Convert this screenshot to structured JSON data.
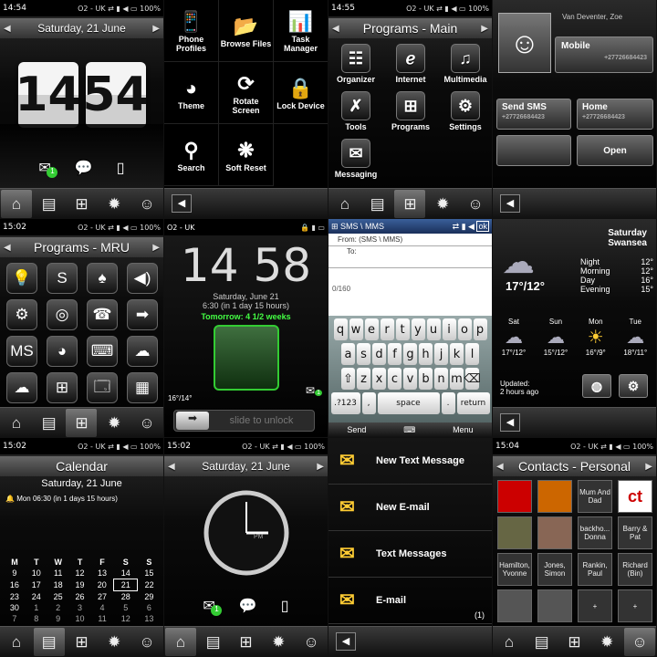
{
  "p1": {
    "time": "14:54",
    "carrier": "O2 - UK",
    "battery": "100%",
    "date": "Saturday, 21 June",
    "hour": "14",
    "minute": "54",
    "badge": "1"
  },
  "p2": {
    "tiles": [
      {
        "icon": "phone-icon",
        "glyph": "📱",
        "label": "Phone\nProfiles"
      },
      {
        "icon": "folder-icon",
        "glyph": "📂",
        "label": "Browse Files"
      },
      {
        "icon": "task-icon",
        "glyph": "📊",
        "label": "Task\nManager"
      },
      {
        "icon": "theme-icon",
        "glyph": "◕",
        "label": "Theme"
      },
      {
        "icon": "rotate-icon",
        "glyph": "⟳",
        "label": "Rotate\nScreen"
      },
      {
        "icon": "lock-icon",
        "glyph": "🔒",
        "label": "Lock Device"
      },
      {
        "icon": "search-icon",
        "glyph": "⚲",
        "label": "Search"
      },
      {
        "icon": "reset-icon",
        "glyph": "❋",
        "label": "Soft Reset"
      }
    ]
  },
  "p3": {
    "time": "14:55",
    "carrier": "O2 - UK",
    "battery": "100%",
    "title": "Programs - Main",
    "items": [
      {
        "icon": "organizer-icon",
        "glyph": "☷",
        "label": "Organizer"
      },
      {
        "icon": "internet-icon",
        "glyph": "ℯ",
        "label": "Internet"
      },
      {
        "icon": "multimedia-icon",
        "glyph": "♫",
        "label": "Multimedia"
      },
      {
        "icon": "tools-icon",
        "glyph": "✗",
        "label": "Tools"
      },
      {
        "icon": "programs-icon",
        "glyph": "⊞",
        "label": "Programs"
      },
      {
        "icon": "settings-icon",
        "glyph": "⚙",
        "label": "Settings"
      },
      {
        "icon": "messaging-icon",
        "glyph": "✉",
        "label": "Messaging"
      }
    ]
  },
  "p4": {
    "name": "Van Deventer, Zoe",
    "mobile_label": "Mobile",
    "mobile_num": "+27726684423",
    "sms_label": "Send SMS",
    "sms_num": "+27726684423",
    "home_label": "Home",
    "home_num": "+27726684423",
    "open_label": "Open"
  },
  "p5": {
    "time": "15:02",
    "carrier": "O2 - UK",
    "battery": "100%",
    "title": "Programs - MRU",
    "icons": [
      "💡",
      "S",
      "♠",
      "◀)",
      "⚙",
      "◎",
      "☎",
      "➡",
      "MS",
      "◕",
      "⌨",
      "☁",
      "☁",
      "⊞",
      "🗔",
      "▦"
    ]
  },
  "p6": {
    "carrier": "O2 - UK",
    "hour": "14",
    "minute": "58",
    "date": "Saturday, June 21",
    "alarm": "6:30 (in 1 day 15 hours)",
    "tomorrow": "Tomorrow: 4 1/2 weeks",
    "temp": "16°/14°",
    "unlock": "slide to unlock",
    "badge": "1"
  },
  "p7": {
    "title": "SMS \\ MMS",
    "ok": "ok",
    "from_label": "From:",
    "from_val": "(SMS \\ MMS)",
    "to_label": "To:",
    "count": "0/160",
    "rows": [
      [
        "q",
        "w",
        "e",
        "r",
        "t",
        "y",
        "u",
        "i",
        "o",
        "p"
      ],
      [
        "a",
        "s",
        "d",
        "f",
        "g",
        "h",
        "j",
        "k",
        "l"
      ],
      [
        "⇧",
        "z",
        "x",
        "c",
        "v",
        "b",
        "n",
        "m",
        "⌫"
      ]
    ],
    "sym": ".?123",
    "comma": ",",
    "space": "space",
    "period": ".",
    "ret": "return",
    "send": "Send",
    "menu": "Menu"
  },
  "p8": {
    "day": "Saturday",
    "city": "Swansea",
    "temp": "17°/12°",
    "rows": [
      {
        "l": "Night",
        "v": "12°"
      },
      {
        "l": "Morning",
        "v": "12°"
      },
      {
        "l": "Day",
        "v": "16°"
      },
      {
        "l": "Evening",
        "v": "15°"
      }
    ],
    "forecast": [
      {
        "d": "Sat",
        "t": "17°/12°"
      },
      {
        "d": "Sun",
        "t": "15°/12°"
      },
      {
        "d": "Mon",
        "t": "16°/9°"
      },
      {
        "d": "Tue",
        "t": "18°/11°"
      }
    ],
    "updated": "Updated:",
    "ago": "2 hours ago"
  },
  "p9": {
    "time": "15:02",
    "carrier": "O2 - UK",
    "battery": "100%",
    "title": "Calendar",
    "date": "Saturday, 21 June",
    "alarm": "Mon 06:30 (in 1 days 15 hours)",
    "head": [
      "M",
      "T",
      "W",
      "T",
      "F",
      "S",
      "S"
    ],
    "weeks": [
      [
        "9",
        "10",
        "11",
        "12",
        "13",
        "14",
        "15"
      ],
      [
        "16",
        "17",
        "18",
        "19",
        "20",
        "21",
        "22"
      ],
      [
        "23",
        "24",
        "25",
        "26",
        "27",
        "28",
        "29"
      ],
      [
        "30",
        "1",
        "2",
        "3",
        "4",
        "5",
        "6"
      ],
      [
        "7",
        "8",
        "9",
        "10",
        "11",
        "12",
        "13"
      ]
    ]
  },
  "p10": {
    "time": "15:02",
    "carrier": "O2 - UK",
    "battery": "100%",
    "date": "Saturday, 21 June",
    "pm": "PM",
    "badge": "1"
  },
  "p11": {
    "items": [
      {
        "icon": "sms-icon",
        "glyph": "✉",
        "label": "New Text Message"
      },
      {
        "icon": "email-icon",
        "glyph": "✉",
        "label": "New E-mail"
      },
      {
        "icon": "text-messages-icon",
        "glyph": "✉",
        "label": "Text Messages"
      },
      {
        "icon": "email-inbox-icon",
        "glyph": "✉",
        "label": "E-mail"
      }
    ],
    "count": "(1)"
  },
  "p12": {
    "time": "15:04",
    "carrier": "O2 - UK",
    "battery": "100%",
    "title": "Contacts - Personal",
    "contacts": [
      "",
      "",
      "Mum And Dad",
      "ct",
      "",
      "",
      "backho... Donna",
      "Barry & Pat",
      "Hamilton, Yvonne",
      "Jones, Simon",
      "Rankin, Paul",
      "Richard (Bin)",
      "",
      "",
      "+",
      "+"
    ]
  },
  "tabs": [
    "⌂",
    "▤",
    "⊞",
    "✹",
    "☺"
  ]
}
